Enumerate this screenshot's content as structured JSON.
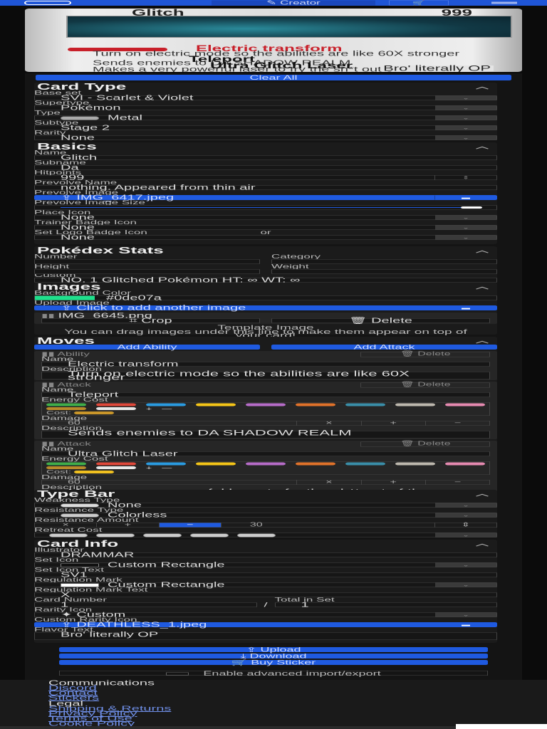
{
  "nav": {
    "creator": "Creator",
    "cart_icon": "cart-icon"
  },
  "card": {
    "name": "Glitch",
    "hp": "999",
    "ability_tag": "Ability",
    "ability_name": "Electric transform",
    "ability_desc": "Turn on electric mode so the abilities are like 60X stronger",
    "atk1": "Teleport",
    "atk1_desc": "Sends enemies to DA SHADOW REALM",
    "atk2": "Ultra Glitch Laser",
    "atk2_desc": "Makes a very powerful laser to fry the sh*t out of the enemy",
    "flavor": "Bro' literally OP"
  },
  "clear_all": "Clear All",
  "card_type": {
    "title": "Card Type",
    "fields": [
      {
        "label": "Base set",
        "value": "SVI - Scarlet & Violet"
      },
      {
        "label": "Supertype",
        "value": "Pokémon"
      },
      {
        "label": "Type",
        "value": "Metal"
      },
      {
        "label": "Subtype",
        "value": "Stage 2"
      },
      {
        "label": "Rarity",
        "value": "None"
      }
    ]
  },
  "basics": {
    "title": "Basics",
    "name_label": "Name",
    "name": "Glitch",
    "subname_label": "Subname",
    "subname": "Da",
    "hp_label": "Hitpoints",
    "hp": "999",
    "prevolve_name_label": "Prevolve Name",
    "prevolve_name": "nothing. Appeared from thin air",
    "prevolve_image_label": "Prevolve Image",
    "prevolve_image": "IMG_6417.jpeg",
    "prevolve_size_label": "Prevolve Image Size",
    "prevolve_size": 1.0,
    "placeicon_label": "Place Icon",
    "placeicon": "None",
    "trainer_badge_label": "Trainer Badge Icon",
    "trainer_badge": "None",
    "or": "or",
    "set_badge_label": "Set Logo Badge Icon",
    "set_badge": "None"
  },
  "pokedex": {
    "title": "Pokédex Stats",
    "number_label": "Number",
    "category_label": "Category",
    "height_label": "Height",
    "weight_label": "Weight",
    "custom_label": "Custom",
    "custom": "NO. 1 Glitched Pokémon HT: ∞ WT: ∞"
  },
  "images": {
    "title": "Images",
    "bg_label": "Background Color",
    "bg_value": "#0de07a",
    "bg_color": "#1ee08c",
    "upload_label": "Upload Image",
    "upload_button": "Click to add another image",
    "file": "IMG_6645.png",
    "crop": "Crop",
    "delete": "Delete",
    "template_title": "Template Image",
    "template_hint": "You can drag images under this line to make them appear on top of your card!"
  },
  "moves": {
    "title": "Moves",
    "add_ability": "Add Ability",
    "add_attack": "Add Attack",
    "name_label": "Name",
    "desc_label": "Description",
    "energy_label": "Energy Cost",
    "damage_label": "Damage",
    "cost_label": "Cost:",
    "delete": "Delete",
    "items": [
      {
        "kind": "Ability",
        "name": "Electric transform",
        "desc": "Turn on electric mode so the abilities are like 60X stronger"
      },
      {
        "kind": "Attack",
        "name": "Teleport",
        "damage": "60",
        "desc": "Sends enemies to DA SHADOW REALM",
        "cost_color": "#c9962a"
      },
      {
        "kind": "Attack",
        "name": "Ultra Glitch Laser",
        "damage": "60",
        "desc": "Makes a very powerful laser to fry the sh*t out of the enemy",
        "cost_color": "#f0c020"
      }
    ],
    "energy_colors": [
      "#3fae4a",
      "#e0483a",
      "#2a9be0",
      "#f5c518",
      "#b66cc8",
      "#e0722a",
      "#3a8ea8",
      "#bdb8ae",
      "#e58ab0",
      "#b88a2a",
      "#e8e8e8"
    ],
    "dmg_ops": [
      "×",
      "+",
      "−"
    ]
  },
  "type_bar": {
    "title": "Type Bar",
    "weak_label": "Weakness Type",
    "weak": "None",
    "res_label": "Resistance Type",
    "res": "Colorless",
    "amount_label": "Resistance Amount",
    "amount_ops": [
      "×",
      "+",
      "−"
    ],
    "amount": "30",
    "retreat_label": "Retreat Cost"
  },
  "card_info": {
    "title": "Card Info",
    "illus_label": "Illustrator",
    "illus": "DRAMMAR",
    "set_icon_label": "Set Icon",
    "set_icon": "Custom Rectangle",
    "set_text_label": "Set Icon Text",
    "set_text": "SV1",
    "reg_label": "Regulation Mark",
    "reg": "Custom Rectangle",
    "reg_text_label": "Regulation Mark Text",
    "reg_text": "X",
    "number_label": "Card Number",
    "number": "1",
    "slash": "/",
    "total_label": "Total in Set",
    "total": "1",
    "rarity_label": "Rarity Icon",
    "rarity": "Custom",
    "custom_rarity_label": "Custom Rarity Icon",
    "custom_rarity": "DEATHLESS_1.jpeg",
    "flavor_label": "Flavor Text",
    "flavor": "Bro' literally OP"
  },
  "actions": {
    "upload": "Upload",
    "download": "Download",
    "buy": "Buy Sticker",
    "advanced": "Enable advanced import/export"
  },
  "footer": {
    "comm_title": "Communications",
    "comm": [
      "Discord",
      "Contact",
      "Stickers"
    ],
    "legal_title": "Legal",
    "legal": [
      "Shipping & Returns",
      "Privacy Policy",
      "Terms of Use",
      "Cookie Policy"
    ]
  }
}
